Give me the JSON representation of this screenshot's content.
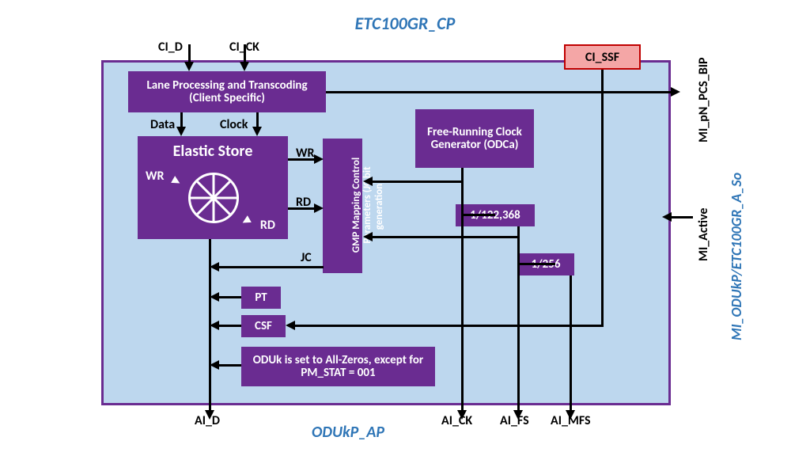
{
  "title_top": "ETC100GR_CP",
  "title_bottom": "ODUkP_AP",
  "right_label": "MI_ODUkP/ETC100GR_A_So",
  "inputs": {
    "ci_d": "CI_D",
    "ci_ck": "CI_CK",
    "ci_ssf": "CI_SSF"
  },
  "outputs": {
    "ai_d": "AI_D",
    "ai_ck": "AI_CK",
    "ai_fs": "AI_FS",
    "ai_mfs": "AI_MFS",
    "mi_pcs_bip": "MI_pN_PCS_BIP",
    "mi_active": "MI_Active"
  },
  "blocks": {
    "lane": "Lane Processing and Transcoding (Client Specific)",
    "elastic": "Elastic Store",
    "gmp": "GMP Mapping Control Parameters (JC bit generation)",
    "freerun": "Free-Running Clock Generator (ODCa)",
    "div1": "1/122,368",
    "div2": "1/256",
    "pt": "PT",
    "csf": "CSF",
    "oduk": "ODUk is set to All-Zeros, except for PM_STAT = 001"
  },
  "signals": {
    "data": "Data",
    "clock": "Clock",
    "wr": "WR",
    "rd": "RD",
    "jc": "JC",
    "wr2": "WR",
    "rd2": "RD"
  }
}
